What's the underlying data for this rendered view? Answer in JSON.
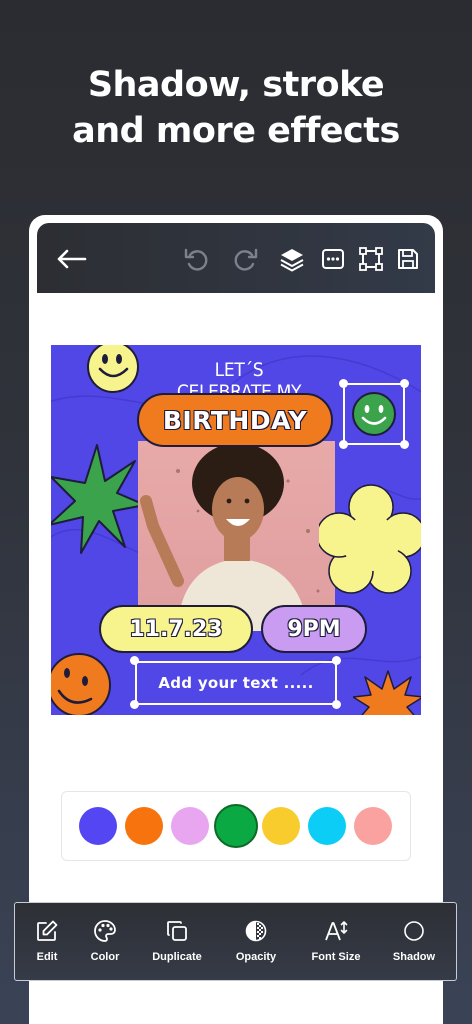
{
  "headline": {
    "line1": "Shadow, stroke",
    "line2": "and more effects"
  },
  "topbar": {
    "icons": [
      "back-arrow-icon",
      "undo-icon",
      "redo-icon",
      "layers-icon",
      "more-icon",
      "crop-frame-icon",
      "save-icon"
    ]
  },
  "design": {
    "caption_top": "LET´S CELEBRATE MY",
    "title": "BIRTHDAY",
    "date": "11.7.23",
    "time": "9PM",
    "text_box": "Add your text .....",
    "background_color": "#5146e6"
  },
  "swatches": [
    {
      "color": "#5446f2"
    },
    {
      "color": "#f7730e"
    },
    {
      "color": "#e8a6f0"
    },
    {
      "color": "#0aa944",
      "selected": true
    },
    {
      "color": "#f9cc2e"
    },
    {
      "color": "#0ccdf5"
    },
    {
      "color": "#f9a2a0"
    }
  ],
  "toolbar": {
    "items": [
      {
        "label": "Edit",
        "icon": "edit-icon"
      },
      {
        "label": "Color",
        "icon": "palette-icon"
      },
      {
        "label": "Duplicate",
        "icon": "duplicate-icon"
      },
      {
        "label": "Opacity",
        "icon": "opacity-icon"
      },
      {
        "label": "Font Size",
        "icon": "font-size-icon"
      },
      {
        "label": "Shadow",
        "icon": "shadow-icon"
      }
    ]
  }
}
